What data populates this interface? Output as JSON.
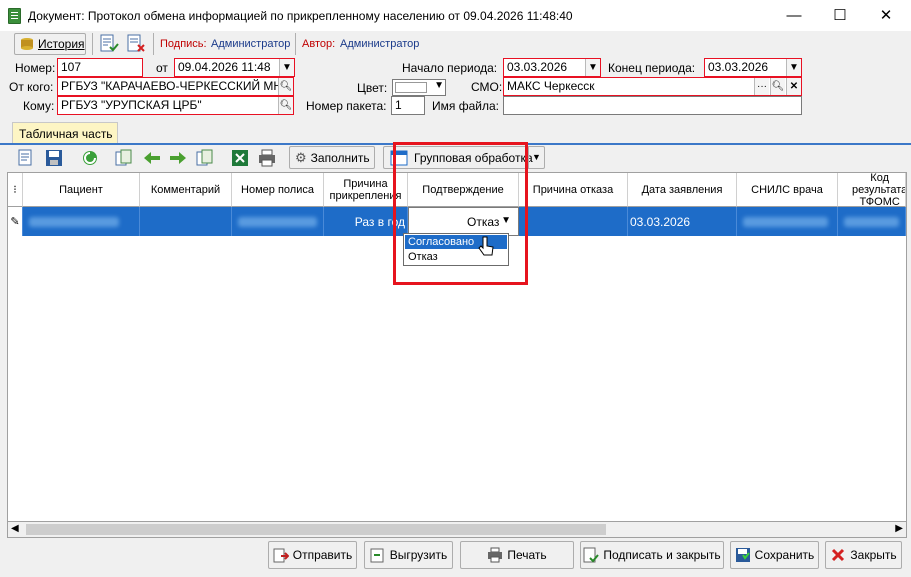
{
  "window": {
    "title": "Документ: Протокол обмена информацией по прикрепленному населению от 09.04.2026 11:48:40",
    "minimize": "—",
    "maximize": "☐",
    "close": "✕"
  },
  "toolbar": {
    "history": "История",
    "signature_label": "Подпись:",
    "signature_value": "Администратор",
    "author_label": "Автор:",
    "author_value": "Администратор"
  },
  "form": {
    "number_label": "Номер:",
    "number_value": "107",
    "from_date_label": "от",
    "from_date_value": "09.04.2026 11:48",
    "period_start_label": "Начало периода:",
    "period_start_value": "03.03.2026",
    "period_end_label": "Конец периода:",
    "period_end_value": "03.03.2026",
    "from_label": "От кого:",
    "from_value": "РГБУЗ \"КАРАЧАЕВО-ЧЕРКЕССКИЙ МНО",
    "color_label": "Цвет:",
    "smo_label": "СМО:",
    "smo_value": "МАКС Черкесск",
    "to_label": "Кому:",
    "to_value": "РГБУЗ \"УРУПСКАЯ ЦРБ\"",
    "packet_label": "Номер пакета:",
    "packet_value": "1",
    "filename_label": "Имя файла:",
    "filename_value": ""
  },
  "tabs": {
    "table_part": "Табличная часть"
  },
  "grid_toolbar": {
    "fill": "Заполнить",
    "group": "Групповая обработка"
  },
  "grid": {
    "headers": [
      "Пациент",
      "Комментарий",
      "Номер полиса",
      "Причина прикрепления",
      "Подтверждение",
      "Причина отказа",
      "Дата заявления",
      "СНИЛС врача",
      "Код результата ТФОМС"
    ],
    "row": {
      "reason": "Раз в год",
      "confirmation": "Отказ",
      "date": "03.03.2026"
    }
  },
  "dropdown": {
    "options": [
      "Согласовано",
      "Отказ"
    ]
  },
  "buttons": {
    "send": "Отправить",
    "export": "Выгрузить",
    "print": "Печать",
    "sign_close": "Подписать и закрыть",
    "save": "Сохранить",
    "close": "Закрыть"
  },
  "colors": {
    "selection": "#1e6cc8",
    "highlight": "#e6141e",
    "tab": "#fdf5c4"
  }
}
